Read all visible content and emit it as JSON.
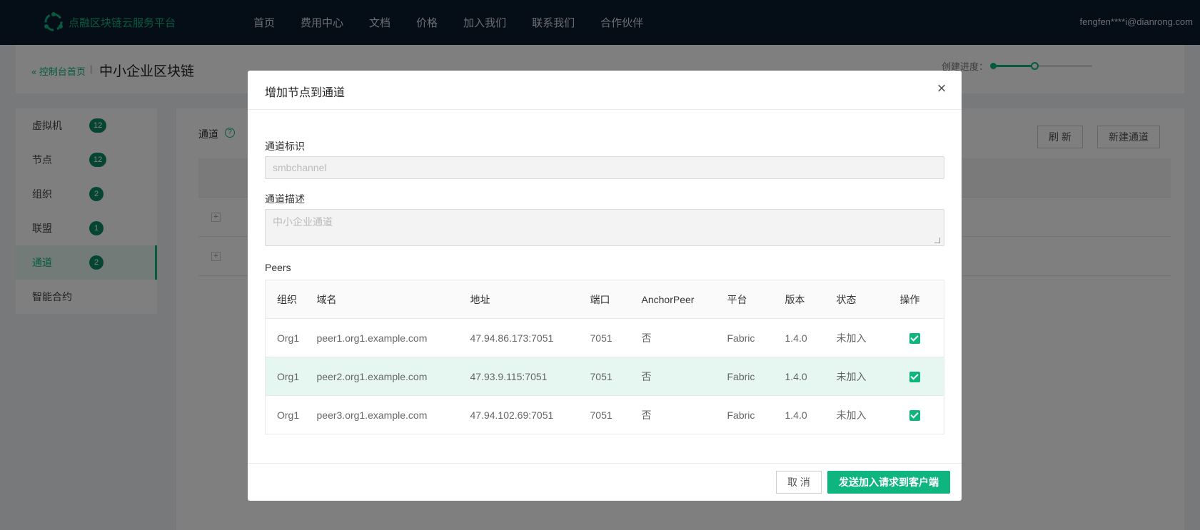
{
  "topbar": {
    "brand": "点融区块链云服务平台",
    "nav": [
      "首页",
      "费用中心",
      "文档",
      "价格",
      "加入我们",
      "联系我们",
      "合作伙伴"
    ],
    "user": "fengfen****i@dianrong.com"
  },
  "header": {
    "back_label": "控制台首页",
    "separator": "|",
    "title": "中小企业区块链",
    "progress_label": "创建进度：",
    "progress_fraction": 0.42
  },
  "sidebar": {
    "items": [
      {
        "label": "虚拟机",
        "badge": "12"
      },
      {
        "label": "节点",
        "badge": "12"
      },
      {
        "label": "组织",
        "badge": "2"
      },
      {
        "label": "联盟",
        "badge": "1"
      },
      {
        "label": "通道",
        "badge": "2"
      },
      {
        "label": "智能合约",
        "badge": ""
      }
    ],
    "active_index": 4
  },
  "content": {
    "title": "通道",
    "help_glyph": "?",
    "refresh_label": "刷 新",
    "new_channel_label": "新建通道",
    "expand_glyph": "+"
  },
  "modal": {
    "title": "增加节点到通道",
    "close_glyph": "×",
    "channel_id_label": "通道标识",
    "channel_id_value": "smbchannel",
    "channel_desc_label": "通道描述",
    "channel_desc_value": "中小企业通道",
    "peers_label": "Peers",
    "columns": [
      "组织",
      "域名",
      "地址",
      "端口",
      "AnchorPeer",
      "平台",
      "版本",
      "状态",
      "操作"
    ],
    "rows": [
      {
        "org": "Org1",
        "domain": "peer1.org1.example.com",
        "address": "47.94.86.173:7051",
        "port": "7051",
        "anchor": "否",
        "platform": "Fabric",
        "version": "1.4.0",
        "status": "未加入",
        "checked": true
      },
      {
        "org": "Org1",
        "domain": "peer2.org1.example.com",
        "address": "47.93.9.115:7051",
        "port": "7051",
        "anchor": "否",
        "platform": "Fabric",
        "version": "1.4.0",
        "status": "未加入",
        "checked": true
      },
      {
        "org": "Org1",
        "domain": "peer3.org1.example.com",
        "address": "47.94.102.69:7051",
        "port": "7051",
        "anchor": "否",
        "platform": "Fabric",
        "version": "1.4.0",
        "status": "未加入",
        "checked": true
      }
    ],
    "highlighted_row": 1,
    "cancel_label": "取 消",
    "submit_label": "发送加入请求到客户端"
  },
  "colors": {
    "accent": "#0fb57f",
    "topbar": "#0b1a2c",
    "badge": "#0d8a62",
    "row_highlight": "#e6f7f1"
  }
}
